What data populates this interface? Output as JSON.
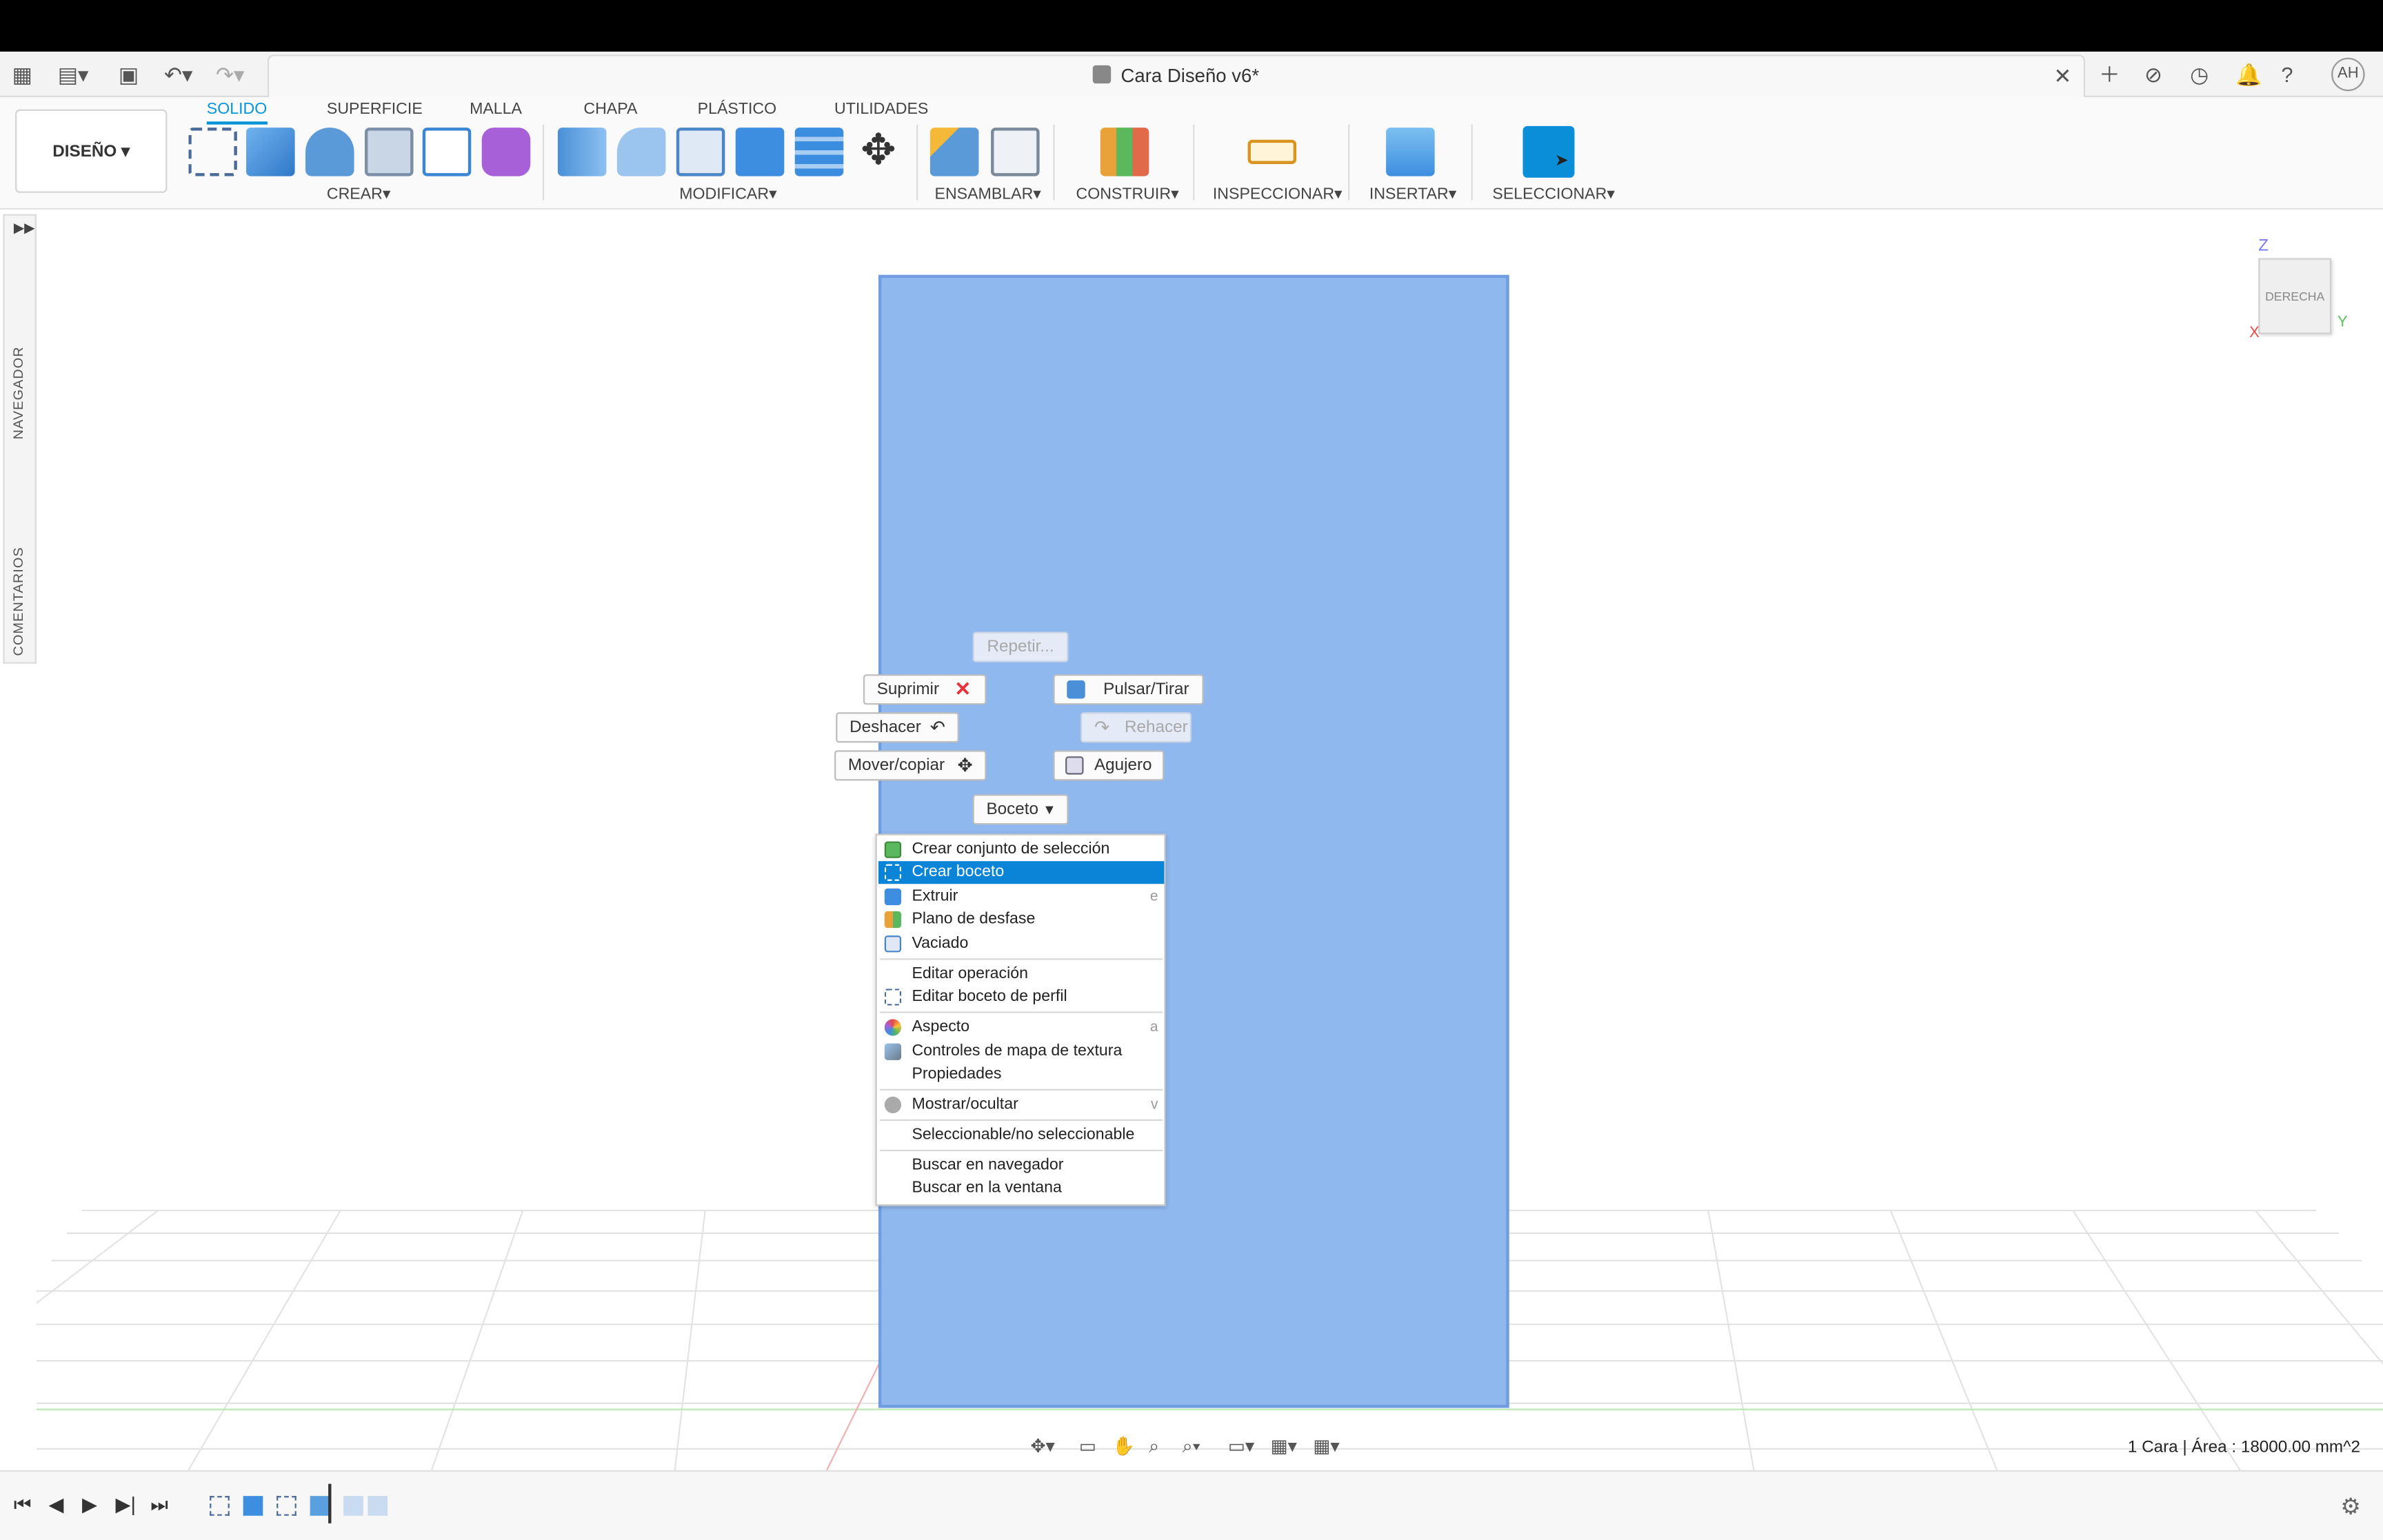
{
  "window": {
    "title": "Cara Diseño v6*",
    "user_initials": "AH"
  },
  "ribbon": {
    "workspace": "DISEÑO",
    "tabs": [
      "SOLIDO",
      "SUPERFICIE",
      "MALLA",
      "CHAPA",
      "PLÁSTICO",
      "UTILIDADES"
    ],
    "active_tab": "SOLIDO",
    "groups": {
      "crear": "CREAR",
      "modificar": "MODIFICAR",
      "ensamblar": "ENSAMBLAR",
      "construir": "CONSTRUIR",
      "inspeccionar": "INSPECCIONAR",
      "insertar": "INSERTAR",
      "seleccionar": "SELECCIONAR"
    },
    "dropdown_glyph": "▾"
  },
  "side_panel": {
    "navegador": "NAVEGADOR",
    "comentarios": "COMENTARIOS"
  },
  "marking_menu": {
    "repetir": "Repetir...",
    "suprimir": "Suprimir",
    "pulsar_tirar": "Pulsar/Tirar",
    "deshacer": "Deshacer",
    "rehacer": "Rehacer",
    "mover_copiar": "Mover/copiar",
    "agujero": "Agujero",
    "boceto": "Boceto"
  },
  "context_menu": {
    "crear_conjunto": "Crear conjunto de selección",
    "crear_boceto": "Crear boceto",
    "extruir": "Extruir",
    "extruir_key": "e",
    "plano_desfase": "Plano de desfase",
    "vaciado": "Vaciado",
    "editar_operacion": "Editar operación",
    "editar_boceto_perfil": "Editar boceto de perfil",
    "aspecto": "Aspecto",
    "aspecto_key": "a",
    "controles_textura": "Controles de mapa de textura",
    "propiedades": "Propiedades",
    "mostrar_ocultar": "Mostrar/ocultar",
    "mostrar_ocultar_key": "v",
    "seleccionable": "Seleccionable/no seleccionable",
    "buscar_navegador": "Buscar en navegador",
    "buscar_ventana": "Buscar en la ventana"
  },
  "viewcube": {
    "face": "DERECHA",
    "axis_z": "Z",
    "axis_y": "Y",
    "axis_x": "X"
  },
  "status_bar": {
    "selection_info": "1 Cara | Área : 18000.00 mm^2"
  },
  "colors": {
    "accent": "#0696d7",
    "face_fill": "#8fb8ef",
    "menu_highlight": "#0a84d6",
    "delete_red": "#e8313a"
  }
}
